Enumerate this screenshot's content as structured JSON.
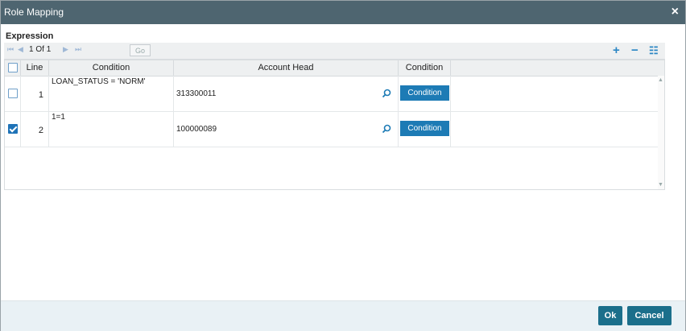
{
  "dialog": {
    "title": "Role Mapping",
    "close_label": "×"
  },
  "section": {
    "label": "Expression"
  },
  "toolbar": {
    "first_icon": "⏮",
    "prev_icon": "◀",
    "page_current": "1",
    "page_of": "Of",
    "page_total": "1",
    "next_icon": "▶",
    "last_icon": "⏭",
    "go_label": "Go",
    "add_icon": "+",
    "remove_icon": "−",
    "columns_icon": "☷"
  },
  "grid": {
    "headers": {
      "select": "",
      "line": "Line",
      "condition": "Condition",
      "account_head": "Account Head",
      "condition_button": "Condition"
    },
    "rows": [
      {
        "checked": false,
        "line": "1",
        "condition": "LOAN_STATUS = 'NORM'",
        "account_head": "313300011",
        "button": "Condition"
      },
      {
        "checked": true,
        "line": "2",
        "condition": "1=1",
        "account_head": "100000089",
        "button": "Condition"
      }
    ]
  },
  "footer": {
    "ok_label": "Ok",
    "cancel_label": "Cancel"
  },
  "colors": {
    "titlebar": "#4e6570",
    "accent": "#1d7bb5",
    "footer_button": "#1b6f8b"
  }
}
